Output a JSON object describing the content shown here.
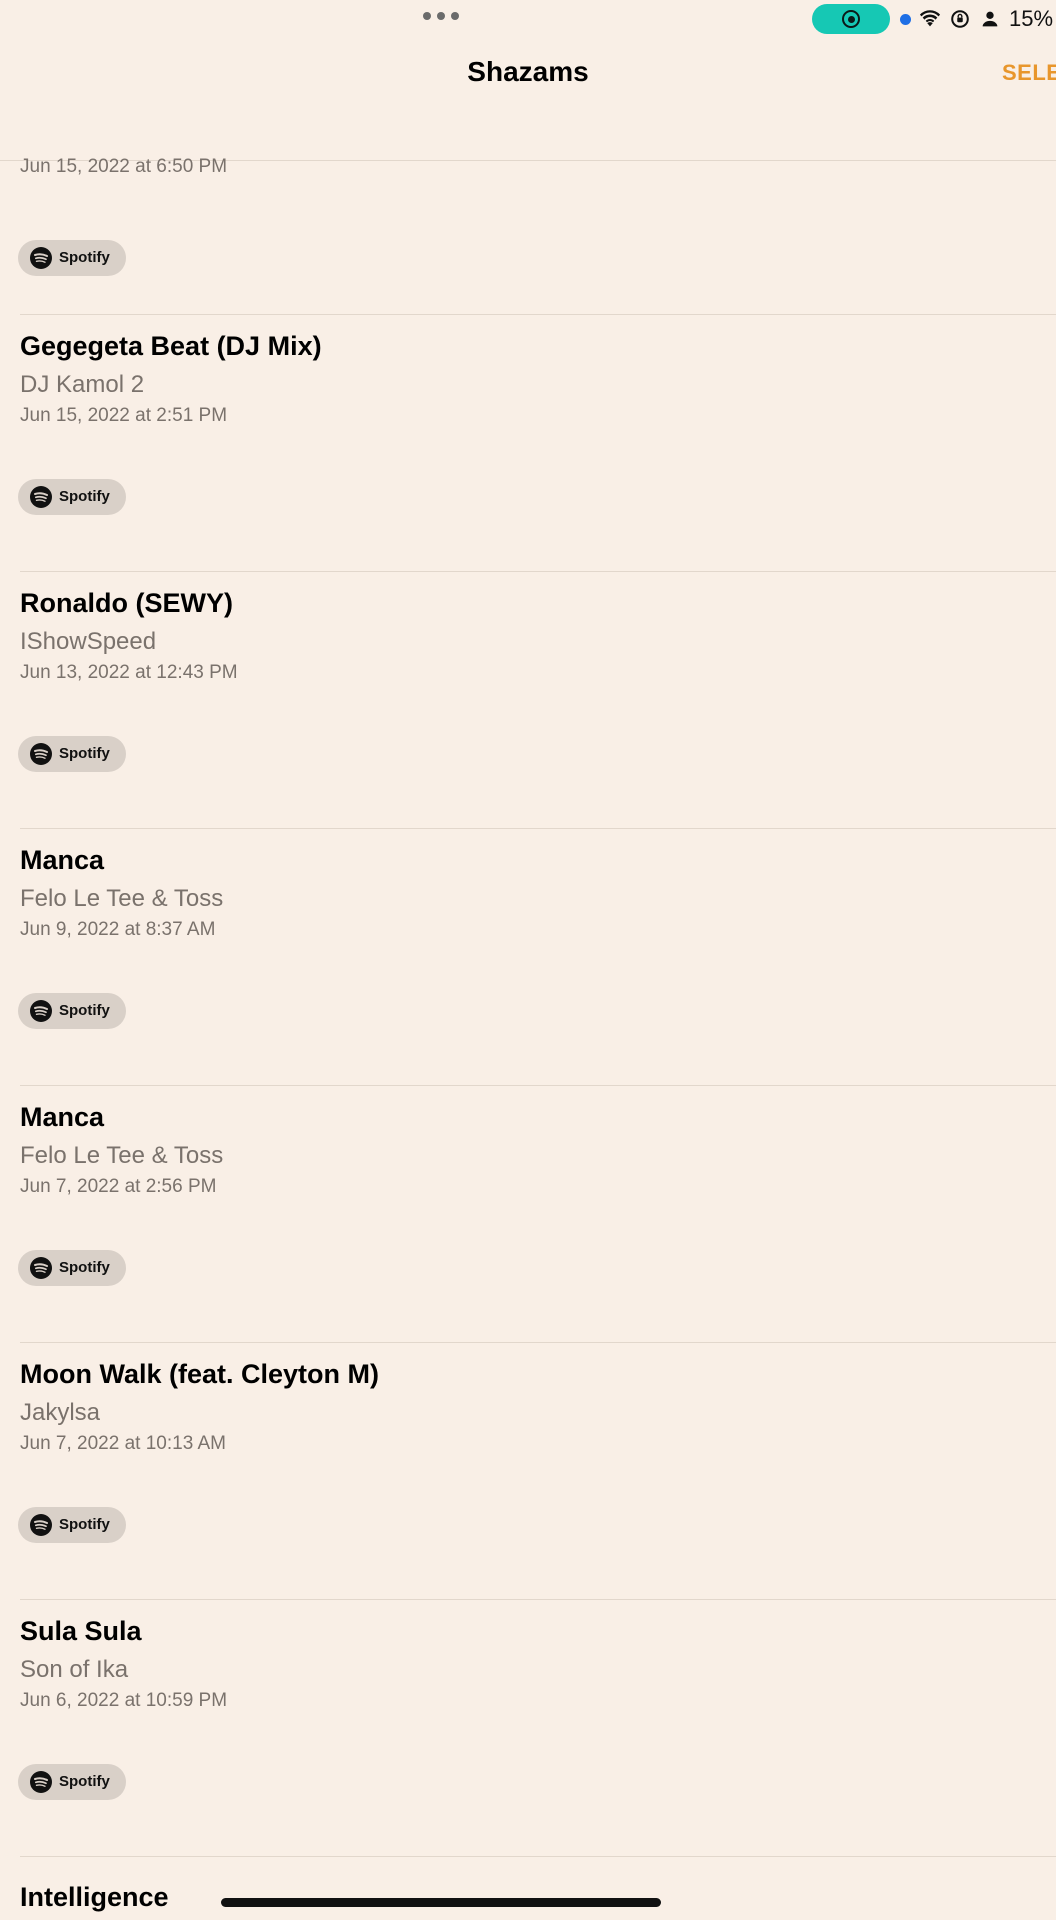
{
  "status_bar": {
    "battery": "15%"
  },
  "header": {
    "title": "Shazams",
    "select_label": "SELE"
  },
  "top_partial_item": {
    "date": "Jun 15, 2022 at 6:50 PM",
    "spotify_label": "Spotify"
  },
  "items": [
    {
      "title": "Gegegeta Beat (DJ Mix)",
      "artist": "DJ Kamol 2",
      "date": "Jun 15, 2022 at 2:51 PM",
      "spotify_label": "Spotify"
    },
    {
      "title": "Ronaldo (SEWY)",
      "artist": "IShowSpeed",
      "date": "Jun 13, 2022 at 12:43 PM",
      "spotify_label": "Spotify"
    },
    {
      "title": "Manca",
      "artist": "Felo Le Tee & Toss",
      "date": "Jun 9, 2022 at 8:37 AM",
      "spotify_label": "Spotify"
    },
    {
      "title": "Manca",
      "artist": "Felo Le Tee & Toss",
      "date": "Jun 7, 2022 at 2:56 PM",
      "spotify_label": "Spotify"
    },
    {
      "title": "Moon Walk (feat. Cleyton M)",
      "artist": "Jakylsa",
      "date": "Jun 7, 2022 at 10:13 AM",
      "spotify_label": "Spotify"
    },
    {
      "title": "Sula Sula",
      "artist": "Son of Ika",
      "date": "Jun 6, 2022 at 10:59 PM",
      "spotify_label": "Spotify"
    }
  ],
  "bottom_partial_item": {
    "title": "Intelligence"
  },
  "icons": {
    "spotify": "spotify-icon",
    "wifi": "wifi-icon",
    "lock_rotation": "orientation-lock-icon",
    "person": "person-icon",
    "battery": "battery-icon",
    "screen_record": "screen-record-icon"
  },
  "colors": {
    "background": "#f9efe6",
    "accent": "#e8962c",
    "record_pill": "#16c8b4"
  }
}
